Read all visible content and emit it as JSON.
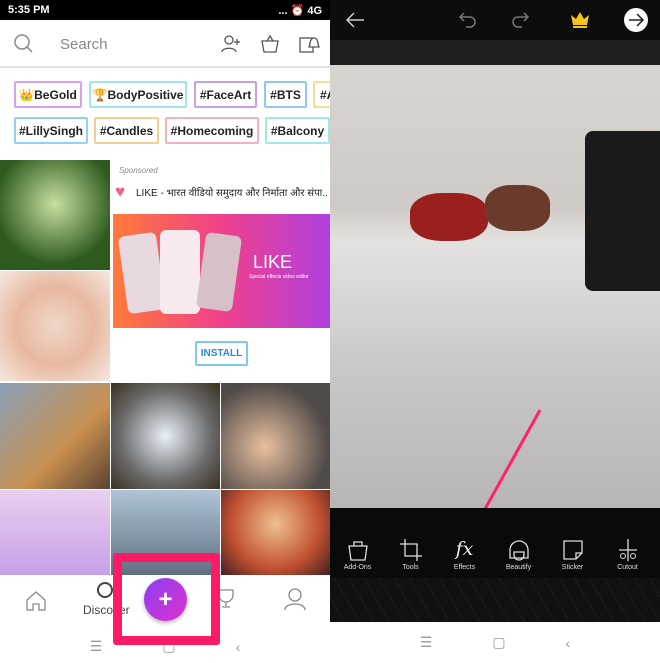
{
  "left": {
    "status": {
      "time": "5:35 PM",
      "indicators": "... ⏰ 4G"
    },
    "search": {
      "placeholder": "Search"
    },
    "tags_row1": [
      "👑BeGold",
      "🏆BodyPositive",
      "#FaceArt",
      "#BTS",
      "#A"
    ],
    "tags_row2": [
      "#LillySingh",
      "#Candles",
      "#Homecoming",
      "#Balcony"
    ],
    "ad": {
      "sponsored": "Sponsored",
      "title": "LIKE - भारत वीडियो समुदाय और निर्माता और संपा...",
      "banner_brand": "LIKE",
      "banner_tagline": "Special effects video editor",
      "install": "INSTALL"
    },
    "bottom_nav": {
      "discover": "Discover",
      "plus": "+"
    },
    "highlight_color": "#ff1a66"
  },
  "right": {
    "tools": [
      {
        "label": "Add-Ons",
        "icon": "bag-icon"
      },
      {
        "label": "Tools",
        "icon": "crop-icon"
      },
      {
        "label": "Effects",
        "icon": "fx-icon"
      },
      {
        "label": "Beautify",
        "icon": "face-icon"
      },
      {
        "label": "Sticker",
        "icon": "sticker-icon"
      },
      {
        "label": "Cutout",
        "icon": "scissors-icon"
      }
    ],
    "fx_glyph": "fx",
    "premium_color": "#f5c518"
  }
}
